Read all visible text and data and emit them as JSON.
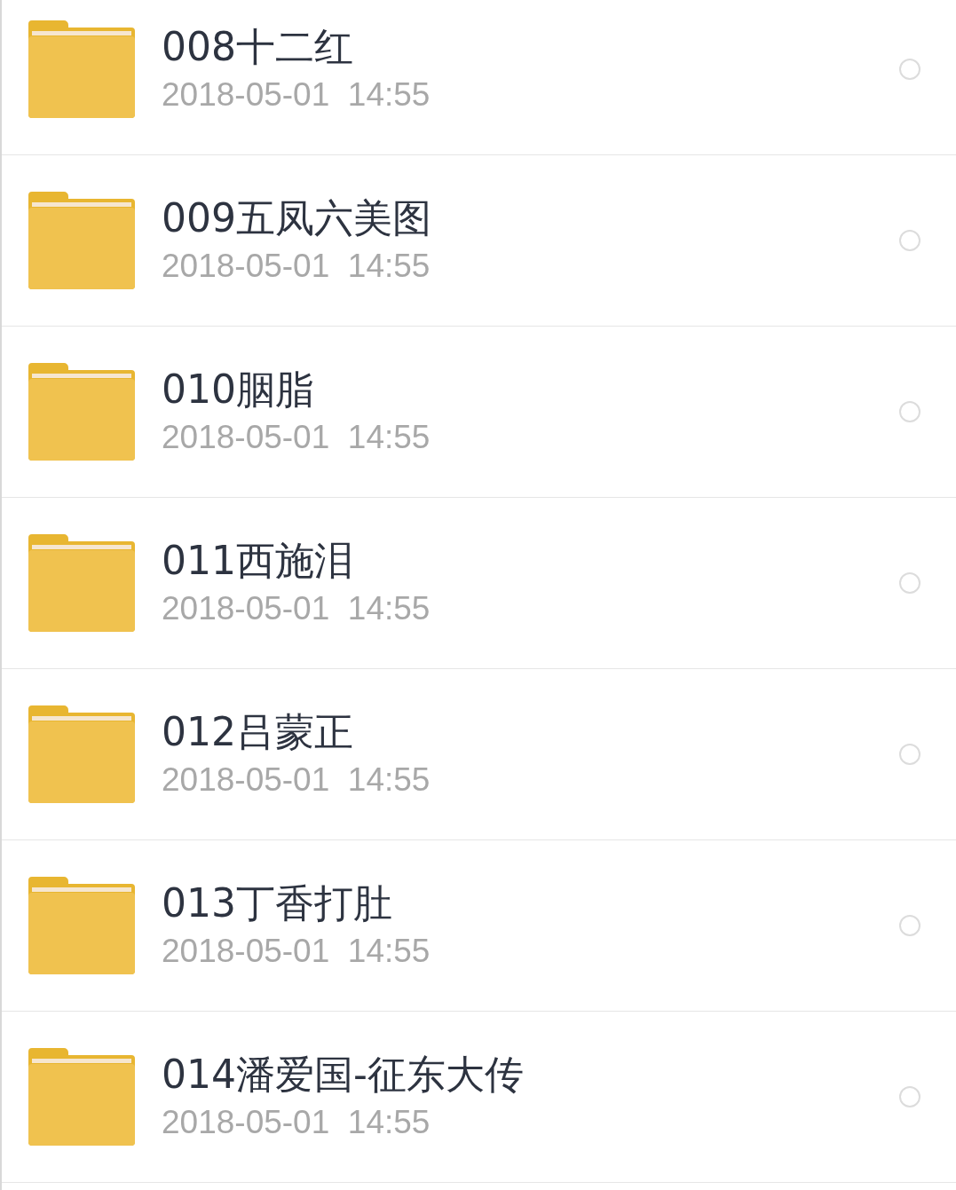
{
  "files": [
    {
      "name": "008十二红",
      "date": "2018-05-01  14:55",
      "selected": false
    },
    {
      "name": "009五凤六美图",
      "date": "2018-05-01  14:55",
      "selected": false
    },
    {
      "name": "010胭脂",
      "date": "2018-05-01  14:55",
      "selected": false
    },
    {
      "name": "011西施泪",
      "date": "2018-05-01  14:55",
      "selected": false
    },
    {
      "name": "012吕蒙正",
      "date": "2018-05-01  14:55",
      "selected": false
    },
    {
      "name": "013丁香打肚",
      "date": "2018-05-01  14:55",
      "selected": false
    },
    {
      "name": "014潘爱国-征东大传",
      "date": "2018-05-01  14:55",
      "selected": false
    }
  ]
}
